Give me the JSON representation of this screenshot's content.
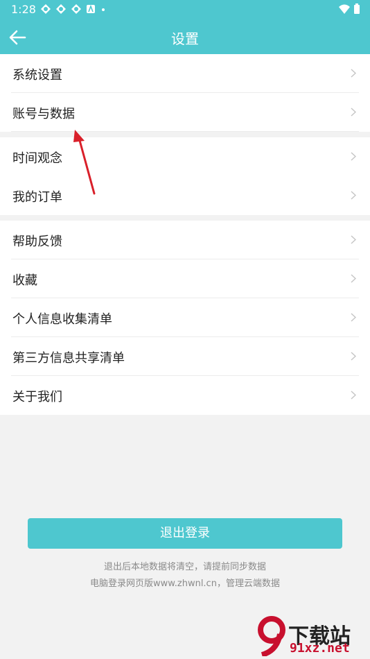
{
  "status_bar": {
    "time": "1:28"
  },
  "app_bar": {
    "title": "设置"
  },
  "groups": [
    {
      "items": [
        {
          "label": "系统设置"
        },
        {
          "label": "账号与数据"
        }
      ]
    },
    {
      "items": [
        {
          "label": "时间观念"
        },
        {
          "label": "我的订单"
        }
      ]
    },
    {
      "items": [
        {
          "label": "帮助反馈"
        },
        {
          "label": "收藏"
        },
        {
          "label": "个人信息收集清单"
        },
        {
          "label": "第三方信息共享清单"
        },
        {
          "label": "关于我们"
        }
      ]
    }
  ],
  "logout": {
    "label": "退出登录"
  },
  "tips": {
    "line1": "退出后本地数据将清空，请提前同步数据",
    "line2": "电脑登录网页版www.zhwnl.cn，管理云端数据"
  },
  "watermark": {
    "text_cn": "下载站",
    "text_url": "91xz.net"
  },
  "colors": {
    "accent": "#4ec7cf",
    "annotation_arrow": "#d9202a"
  },
  "icons": {
    "back": "arrow-left-icon",
    "chevron": "chevron-right-icon"
  }
}
